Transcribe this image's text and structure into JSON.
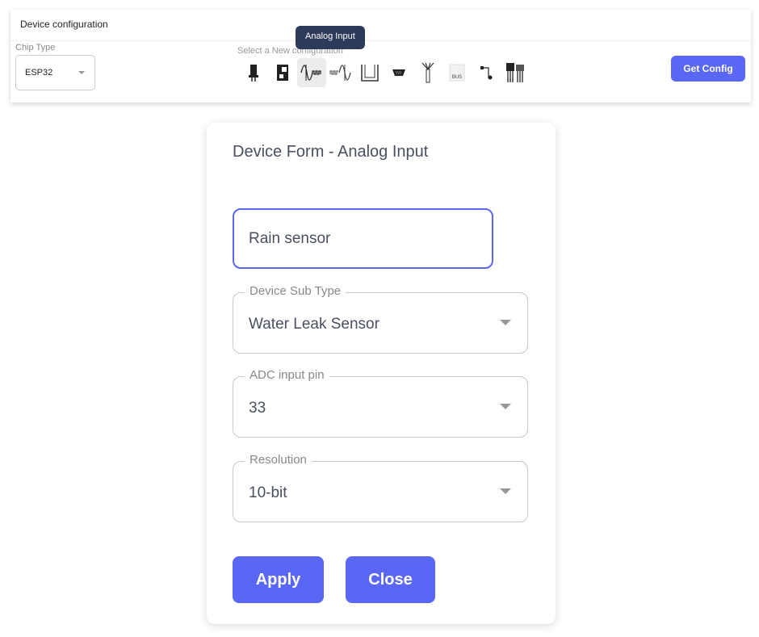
{
  "header": {
    "title": "Device configuration"
  },
  "chip": {
    "label": "Chip Type",
    "value": "ESP32"
  },
  "config": {
    "label": "Select a New configuration",
    "tooltip": "Analog Input",
    "icons": [
      "led-icon",
      "relay-icon",
      "analog-input-icon",
      "analog-output-icon",
      "pulse-icon",
      "serial-port-icon",
      "antenna-icon",
      "one-wire-bus-icon",
      "i2c-icon",
      "transistor-icon"
    ],
    "active": "analog-input-icon",
    "bus_text": "BUS"
  },
  "get_config": "Get Config",
  "form": {
    "title": "Device Form - Analog Input",
    "name_value": "Rain sensor",
    "fields": [
      {
        "label": "Device Sub Type",
        "value": "Water Leak Sensor"
      },
      {
        "label": "ADC input pin",
        "value": "33"
      },
      {
        "label": "Resolution",
        "value": "10-bit"
      }
    ],
    "apply": "Apply",
    "close": "Close"
  },
  "colors": {
    "accent": "#5a67f5",
    "tooltip": "#2e3a59"
  }
}
